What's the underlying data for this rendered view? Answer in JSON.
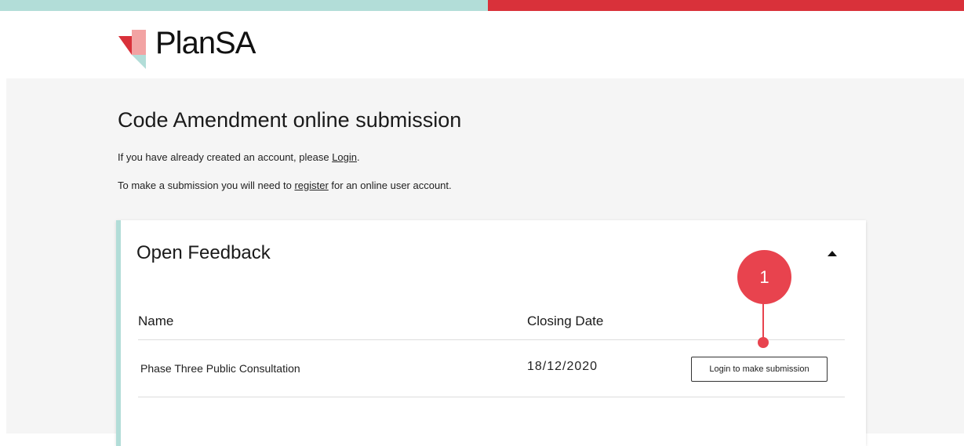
{
  "colors": {
    "topbar_left": "#b2ddd8",
    "topbar_right": "#d9313a",
    "card_accent": "#b2ddd8",
    "callout": "#e8434e",
    "background": "#f5f5f5"
  },
  "header": {
    "logo_icon": "plansa-logo-icon",
    "logo_text": "PlanSA"
  },
  "page": {
    "title": "Code Amendment online submission",
    "login_prefix": "If you have already created an account, please ",
    "login_link": "Login",
    "login_suffix": ".",
    "register_prefix": "To make a submission you will need to ",
    "register_link": "register",
    "register_suffix": " for an online user account."
  },
  "card": {
    "title": "Open Feedback",
    "collapse_icon": "caret-up-icon",
    "columns": [
      "Name",
      "Closing Date"
    ],
    "rows": [
      {
        "name": "Phase Three Public Consultation",
        "closing_date": "18/12/2020",
        "action_label": "Login to make submission"
      }
    ]
  },
  "callout": {
    "number": "1"
  }
}
